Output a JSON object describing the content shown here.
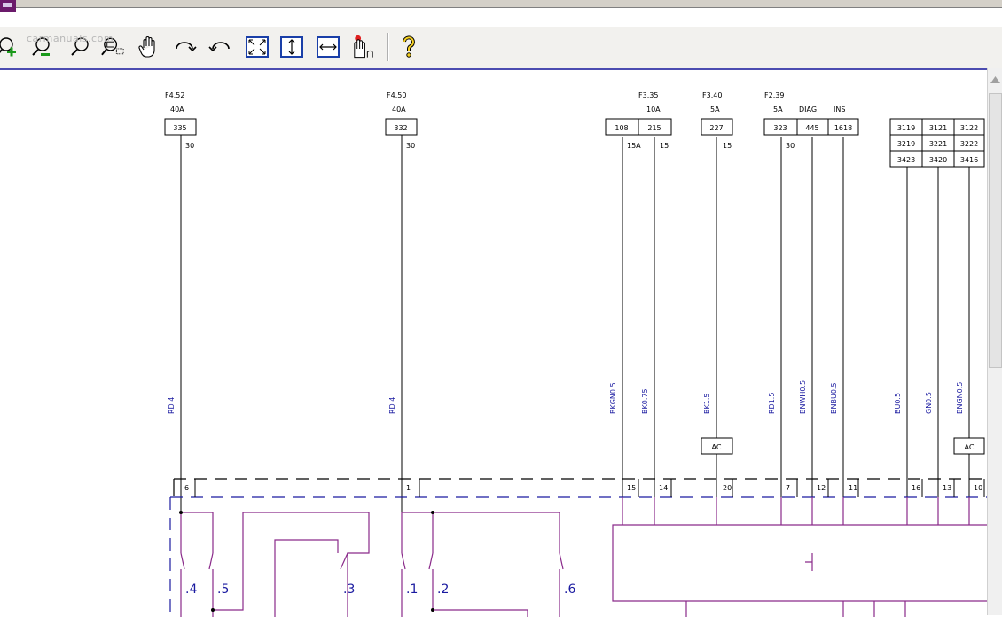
{
  "window": {
    "watermark": "carmanuals.com"
  },
  "toolbar": {
    "buttons": [
      {
        "name": "zoom-in-button",
        "icon": "zoom-in-icon",
        "tooltip": "Zoom In"
      },
      {
        "name": "zoom-out-button",
        "icon": "zoom-out-icon",
        "tooltip": "Zoom Out"
      },
      {
        "name": "zoom-button",
        "icon": "magnifier-icon",
        "tooltip": "Zoom"
      },
      {
        "name": "zoom-window-button",
        "icon": "zoom-window-icon",
        "tooltip": "Zoom Window"
      },
      {
        "name": "pan-button",
        "icon": "hand-icon",
        "tooltip": "Pan"
      },
      {
        "name": "rotate-cw-button",
        "icon": "rotate-cw-icon",
        "tooltip": "Rotate Clockwise"
      },
      {
        "name": "rotate-ccw-button",
        "icon": "rotate-ccw-icon",
        "tooltip": "Rotate Counter-Clockwise"
      },
      {
        "name": "fit-all-button",
        "icon": "fit-all-icon",
        "tooltip": "Fit All"
      },
      {
        "name": "fit-height-button",
        "icon": "fit-height-icon",
        "tooltip": "Fit Height"
      },
      {
        "name": "fit-width-button",
        "icon": "fit-width-icon",
        "tooltip": "Fit Width"
      },
      {
        "name": "highlight-button",
        "icon": "highlight-hand-icon",
        "tooltip": "Highlight"
      },
      {
        "name": "help-button",
        "icon": "help-icon",
        "tooltip": "Help"
      }
    ]
  },
  "schematic": {
    "fuses": [
      {
        "id": "F4.52",
        "rating": "40A",
        "connector": "335",
        "pin": "30",
        "wire": "RD 4",
        "splice": "6"
      },
      {
        "id": "F4.50",
        "rating": "40A",
        "connector": "332",
        "pin": "30",
        "wire": "RD 4",
        "splice": "1"
      }
    ],
    "fuse_group": {
      "headers": [
        {
          "id": "F3.35",
          "rating": "10A"
        },
        {
          "id": "F3.40",
          "rating": "5A"
        },
        {
          "id": "F2.39",
          "rating": "5A"
        },
        {
          "id": "",
          "rating": "DIAG"
        },
        {
          "id": "",
          "rating": "INS"
        }
      ],
      "connectors": [
        "108",
        "215",
        "227",
        "323",
        "445",
        "1618"
      ],
      "pins": [
        "15A",
        "15",
        "15",
        "30"
      ]
    },
    "right_table": [
      [
        "3119",
        "3121",
        "3122"
      ],
      [
        "3219",
        "3221",
        "3222"
      ],
      [
        "3423",
        "3420",
        "3416"
      ]
    ],
    "wires": [
      "BKGN0.5",
      "BK0.75",
      "BK1.5",
      "RD1.5",
      "BNWH0.5",
      "BNBU0.5",
      "BU0.5",
      "GN0.5",
      "BNGN0.5"
    ],
    "ac_labels": [
      "AC",
      "AC"
    ],
    "terminals": [
      "15",
      "14",
      "20",
      "7",
      "12",
      "11",
      "16",
      "13",
      "10"
    ],
    "relay_contacts": [
      ".4",
      ".5",
      ".3",
      ".1",
      ".2",
      ".6"
    ],
    "ic_symbol": "⌐{"
  }
}
